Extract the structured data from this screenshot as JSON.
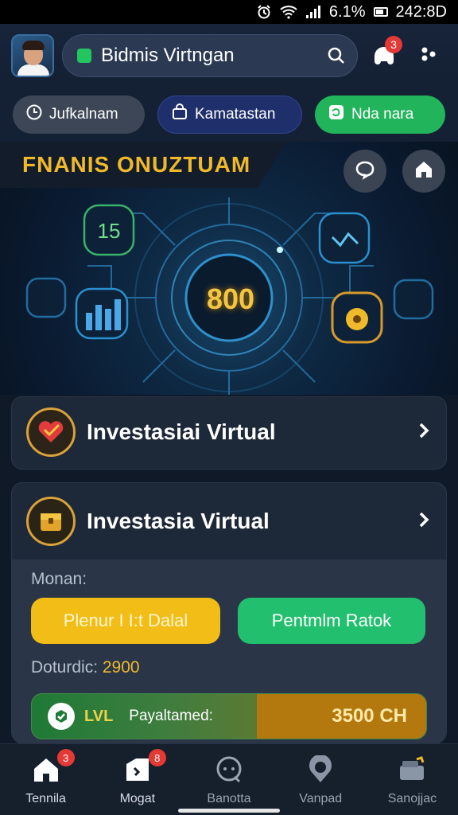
{
  "status_bar": {
    "battery": "6.1%",
    "time": "242:8D"
  },
  "header": {
    "search_text": "Bidmis Virtngan",
    "notification_count": "3",
    "avatar_icon": "user-avatar",
    "menu_icon": "dots-icon"
  },
  "chips": [
    {
      "label": "Jufkalnam",
      "icon": "clock-icon"
    },
    {
      "label": "Kamatastan",
      "icon": "bag-icon"
    },
    {
      "label": "Nda nara",
      "icon": "refresh-icon"
    }
  ],
  "hero": {
    "title": "FNANIS ONUZTUAM",
    "center_value": "800",
    "badge_value": "15"
  },
  "cards": [
    {
      "title": "Investasiai Virtual",
      "icon": "heart-badge-icon"
    },
    {
      "title": "Investasia Virtual",
      "icon": "chest-icon",
      "label": "Monan:",
      "primary_button": "Plenur I I:t Dalal",
      "secondary_button": "Pentmlm Ratok",
      "duration_label": "Doturdic:",
      "duration_value": "2900",
      "level": {
        "tag": "LVL",
        "label": "Payaltamed:",
        "amount": "3500 CH",
        "progress": 0.57
      }
    }
  ],
  "bottom_nav": [
    {
      "label": "Tennila",
      "icon": "home-icon",
      "badge": "3"
    },
    {
      "label": "Mogat",
      "icon": "tag-icon",
      "badge": "8"
    },
    {
      "label": "Banotta",
      "icon": "chat-icon",
      "badge": ""
    },
    {
      "label": "Vanpad",
      "icon": "location-icon",
      "badge": ""
    },
    {
      "label": "Sanojjac",
      "icon": "wallet-icon",
      "badge": ""
    }
  ],
  "colors": {
    "accent_gold": "#f0b92a",
    "accent_green": "#22bf6e",
    "badge_red": "#e53935",
    "background": "#0f1928"
  }
}
